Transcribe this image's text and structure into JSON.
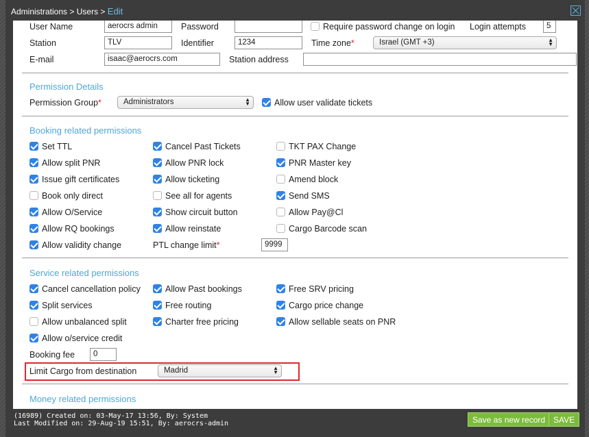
{
  "breadcrumb": {
    "part1": "Administrations",
    "sep": ">",
    "part2": "Users",
    "current": "Edit"
  },
  "user": {
    "user_name_label": "User Name",
    "user_name_value": "aerocrs admin",
    "password_label": "Password",
    "require_pw_label": "Require password change on login",
    "login_attempts_label": "Login attempts",
    "login_attempts_value": "5",
    "station_label": "Station",
    "station_value": "TLV",
    "identifier_label": "Identifier",
    "identifier_value": "1234",
    "timezone_label": "Time zone",
    "timezone_value": "Israel (GMT +3)",
    "email_label": "E-mail",
    "email_value": "isaac@aerocrs.com",
    "station_address_label": "Station address",
    "station_address_value": ""
  },
  "permission": {
    "title": "Permission Details",
    "group_label": "Permission Group",
    "group_value": "Administrators",
    "validate_label": "Allow user validate tickets",
    "validate_checked": true
  },
  "booking": {
    "title": "Booking related permissions",
    "items": [
      {
        "label": "Set TTL",
        "checked": true
      },
      {
        "label": "Cancel Past Tickets",
        "checked": true
      },
      {
        "label": "TKT PAX Change",
        "checked": false
      },
      {
        "label": "Allow split PNR",
        "checked": true
      },
      {
        "label": "Allow PNR lock",
        "checked": true
      },
      {
        "label": "PNR Master key",
        "checked": true
      },
      {
        "label": "Issue gift certificates",
        "checked": true
      },
      {
        "label": "Allow ticketing",
        "checked": true
      },
      {
        "label": "Amend block",
        "checked": false
      },
      {
        "label": "Book only direct",
        "checked": false
      },
      {
        "label": "See all for agents",
        "checked": false
      },
      {
        "label": "Send SMS",
        "checked": true
      },
      {
        "label": "Allow O/Service",
        "checked": true
      },
      {
        "label": "Show circuit button",
        "checked": true
      },
      {
        "label": "Allow Pay@Cl",
        "checked": false
      },
      {
        "label": "Allow RQ bookings",
        "checked": true
      },
      {
        "label": "Allow reinstate",
        "checked": true
      },
      {
        "label": "Cargo Barcode scan",
        "checked": false
      },
      {
        "label": "Allow validity change",
        "checked": true
      }
    ],
    "ptl_label": "PTL change limit",
    "ptl_value": "9999"
  },
  "service": {
    "title": "Service related permissions",
    "items": [
      {
        "label": "Cancel cancellation policy",
        "checked": true
      },
      {
        "label": "Allow Past bookings",
        "checked": true
      },
      {
        "label": "Free SRV pricing",
        "checked": true
      },
      {
        "label": "Split services",
        "checked": true
      },
      {
        "label": "Free routing",
        "checked": true
      },
      {
        "label": "Cargo price change",
        "checked": true
      },
      {
        "label": "Allow unbalanced split",
        "checked": false
      },
      {
        "label": "Charter free pricing",
        "checked": true
      },
      {
        "label": "Allow sellable seats on PNR",
        "checked": true
      },
      {
        "label": "Allow o/service credit",
        "checked": true
      }
    ],
    "booking_fee_label": "Booking fee",
    "booking_fee_value": "0",
    "limit_cargo_label": "Limit Cargo from destination",
    "limit_cargo_value": "Madrid"
  },
  "money": {
    "title": "Money related permissions"
  },
  "footer": {
    "created": "(16989) Created on: 03-May-17 13:56, By: System",
    "modified": "Last Modified on: 29-Aug-19 15:51, By: aerocrs-admin",
    "save_new_label": "Save as new record",
    "save_label": "SAVE"
  },
  "colors": {
    "accent": "#4fa7d6",
    "checkbox": "#2f83e4",
    "button": "#7cbb3b",
    "required": "#e0262b"
  },
  "icons": {
    "close": "close-icon",
    "select_arrows": "updown-arrow-icon",
    "checkmark": "check-icon"
  }
}
